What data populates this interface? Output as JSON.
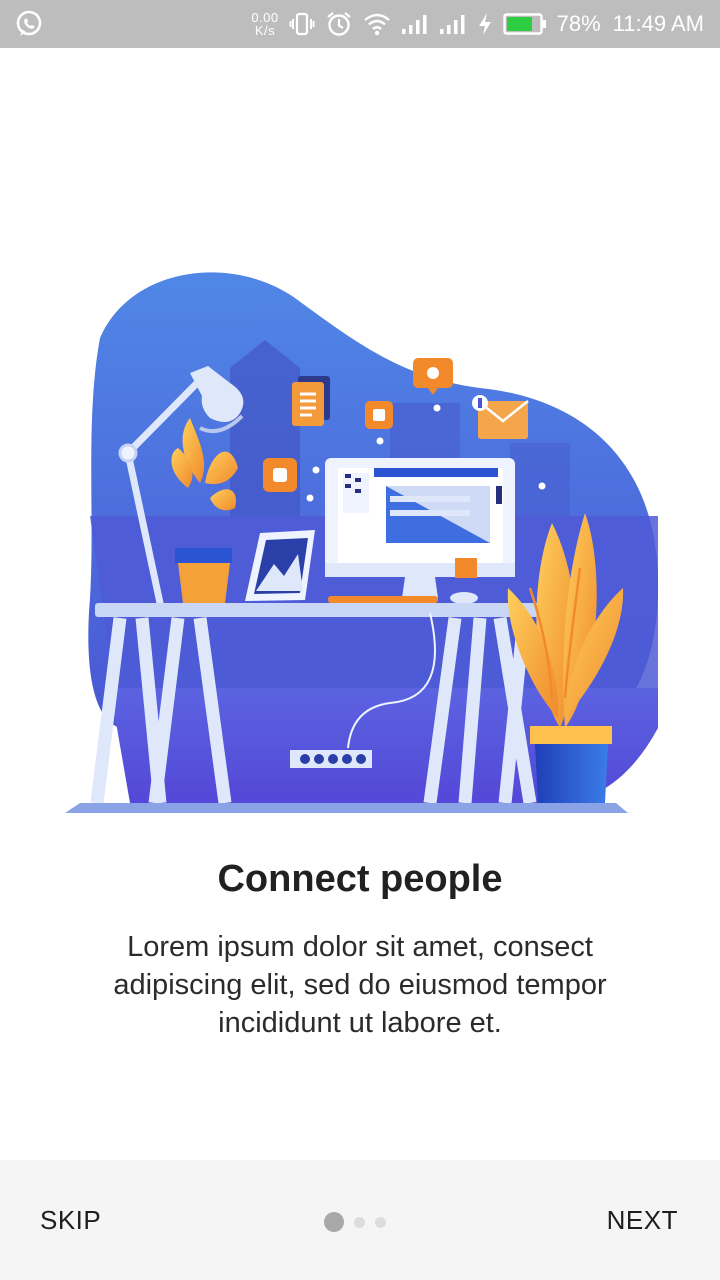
{
  "status_bar": {
    "left_icons": [
      "whatsapp-icon"
    ],
    "net_speed_value": "0.00",
    "net_speed_unit": "K/s",
    "right_icons": [
      "vibrate-icon",
      "alarm-icon",
      "wifi-icon",
      "signal-icon",
      "signal-icon",
      "charging-icon",
      "battery-icon"
    ],
    "battery_percent": "78%",
    "battery_level": 0.78,
    "time": "11:49 AM",
    "background_color": "#bdbdbd"
  },
  "illustration": {
    "subject": "workspace-illustration",
    "colors": {
      "blob": "#5b73e0",
      "blob_dark": "#3f4fc9",
      "accent_orange": "#f39a3b",
      "accent_yellow": "#ffc24f",
      "desk": "#c9d6f5"
    }
  },
  "slide": {
    "title": "Connect people",
    "description": "Lorem ipsum dolor sit amet, consect adipiscing elit, sed do eiusmod tempor incididunt ut labore et."
  },
  "navigation": {
    "skip_label": "SKIP",
    "next_label": "NEXT",
    "page_count": 3,
    "current_page": 1
  }
}
